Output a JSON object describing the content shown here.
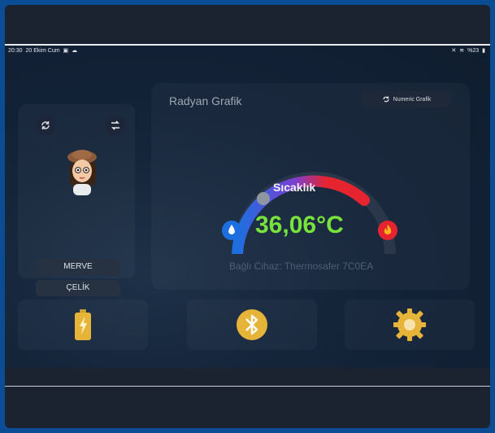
{
  "status_bar": {
    "time": "20:30",
    "date": "20 Ekim Cum",
    "battery": "%23"
  },
  "user_card": {
    "first_name": "MERVE",
    "last_name": "ÇELİK"
  },
  "gauge_card": {
    "title": "Radyan Grafik",
    "numeric_button_label": "Numeric Grafik",
    "gauge_label": "Sıcaklık",
    "temperature": "36,06°C",
    "device": "Bağlı Cihaz: Thermosafer 7C0EA"
  },
  "bottom_panels": {
    "items": [
      {
        "icon": "battery-icon"
      },
      {
        "icon": "bluetooth-icon"
      },
      {
        "icon": "settings-gear-icon"
      }
    ]
  },
  "colors": {
    "accent_green": "#78e33a",
    "cold_blue": "#1d6fe0",
    "hot_red": "#e5242f",
    "gold": "#e7b43a"
  }
}
